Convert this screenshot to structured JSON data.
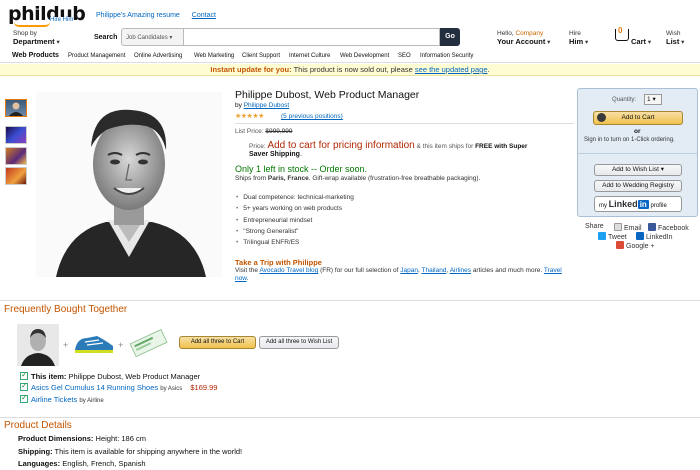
{
  "header": {
    "logo": "phildub",
    "logo_badge": "Hire Him",
    "top_links": [
      "Philippe's Amazing resume",
      "Contact"
    ],
    "shop_by": "Shop by",
    "department": "Department",
    "search_label": "Search",
    "search_category": "Job Candidates",
    "search_value": "",
    "search_go": "Go",
    "account_hello": "Hello,",
    "account_name": "Company",
    "account_label": "Your Account",
    "hire_top": "Hire",
    "hire_bottom": "Him",
    "cart_count": "0",
    "cart_label": "Cart",
    "wish_top": "Wish",
    "wish_bottom": "List"
  },
  "nav": [
    "Web Products",
    "Product Management",
    "Online Advertising",
    "Web Marketing",
    "Client Support",
    "Internet Culture",
    "Web Development",
    "SEO",
    "Information Security"
  ],
  "notice": {
    "lead": "Instant update for you:",
    "text": "This product is now sold out, please",
    "link": "see the updated page",
    "end": "."
  },
  "product": {
    "title": "Philippe Dubost, Web Product Manager",
    "by": "by",
    "author": "Philippe Dubost",
    "stars": "★★★★★",
    "reviews": "(5 previous positions)",
    "list_price_label": "List Price:",
    "list_price": "$999,999",
    "price_label": "Price:",
    "price_red": "Add to cart for pricing information",
    "price_mid": "& this item ships for",
    "price_free": "FREE with Super",
    "price_line2": "Saver Shipping",
    "price_line2_end": ".",
    "stock": "Only 1 left in stock -- Order soon.",
    "ships_from": "Ships from",
    "ships_place": "Paris, France",
    "ships_rest": ". Gift-wrap available (frustration-free breathable packaging).",
    "bullets": [
      "Dual competence: technical-marketing",
      "5+ years working on web products",
      "Entrepreneurial mindset",
      "\"Strong Generalist\"",
      "Trilingual ENFR/ES"
    ],
    "trip_title": "Take a Trip with Philippe",
    "trip_pre": "Visit the",
    "trip_blog": "Avocado Travel blog",
    "trip_mid": "(FR) for our full selection of",
    "trip_japan": "Japan",
    "trip_thailand": "Thailand",
    "trip_airlines": "Airlines",
    "trip_end": "articles and much more.",
    "trip_travel": "Travel now",
    "trip_dot": "."
  },
  "buybox": {
    "quantity_label": "Quantity:",
    "quantity": "1",
    "add_to_cart": "Add to Cart",
    "or": "or",
    "oneclick": "Sign in to turn on 1-Click ordering.",
    "wish_list": "Add to Wish List",
    "wedding": "Add to Wedding Registry",
    "linkedin_my": "my",
    "linkedin_name": "Linked",
    "linkedin_in": "in",
    "linkedin_profile": "profile"
  },
  "share": {
    "label": "Share",
    "email": "Email",
    "facebook": "Facebook",
    "tweet": "Tweet",
    "linkedin": "LinkedIn",
    "google": "Google +"
  },
  "fbt": {
    "title": "Frequently Bought Together",
    "btn_cart": "Add all three to Cart",
    "btn_wish": "Add all three to Wish List",
    "item1_label": "This item:",
    "item1_name": "Philippe Dubost, Web Product Manager",
    "item2_name": "Asics Gel Cumulus 14 Running Shoes",
    "item2_by": "by Asics",
    "item2_price": "$169.99",
    "item3_name": "Airline Tickets",
    "item3_by": "by Airline"
  },
  "details": {
    "title": "Product Details",
    "rows": [
      {
        "label": "Product Dimensions:",
        "value": "Height: 186 cm"
      },
      {
        "label": "Shipping:",
        "value": "This item is available for shipping anywhere in the world!"
      },
      {
        "label": "Languages:",
        "value": "English, French, Spanish"
      }
    ]
  },
  "colors": {
    "accent": "#c45500",
    "link": "#0066c0",
    "price": "#b12704",
    "stock": "#007600",
    "cart_button": "#f0c14b"
  }
}
